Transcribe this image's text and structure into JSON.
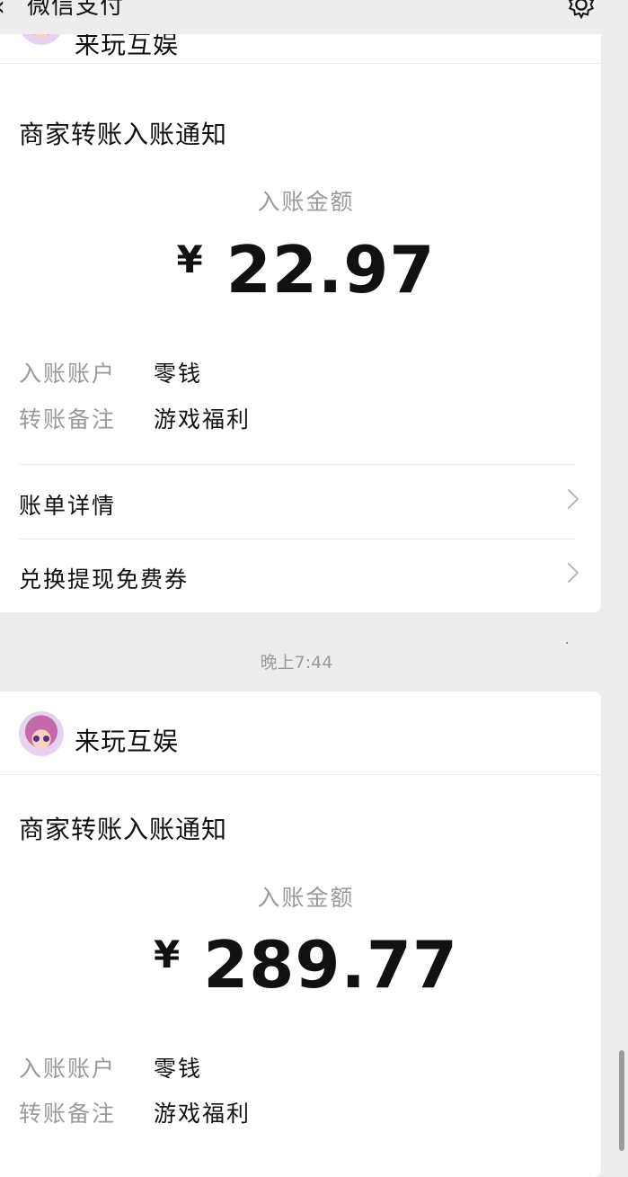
{
  "topbar": {
    "title": "微信支付",
    "back_icon": "chevron-left-icon",
    "settings_icon": "gear-icon"
  },
  "messages": [
    {
      "sender": "来玩互娱",
      "notice_title": "商家转账入账通知",
      "amount_label": "入账金额",
      "currency": "¥",
      "amount": "22.97",
      "rows": [
        {
          "key": "入账账户",
          "value": "零钱"
        },
        {
          "key": "转账备注",
          "value": "游戏福利"
        }
      ],
      "links": [
        {
          "label": "账单详情"
        },
        {
          "label": "兑换提现免费券"
        }
      ]
    },
    {
      "sender": "来玩互娱",
      "notice_title": "商家转账入账通知",
      "amount_label": "入账金额",
      "currency": "¥",
      "amount": "289.77",
      "rows": [
        {
          "key": "入账账户",
          "value": "零钱"
        },
        {
          "key": "转账备注",
          "value": "游戏福利"
        }
      ]
    }
  ],
  "timestamp": "晚上7:44"
}
